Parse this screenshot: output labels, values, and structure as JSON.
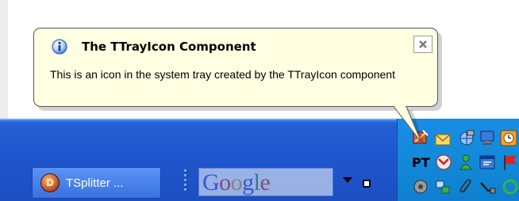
{
  "balloon": {
    "title": "The TTrayIcon Component",
    "message": "This is an icon in the system tray created by the TTrayIcon component",
    "info_icon": "info-icon",
    "close_icon": "close-icon",
    "background_color": "#ffffe1"
  },
  "taskbar": {
    "color": "#1f55cc",
    "task_button": {
      "label": "TSplitter ...",
      "app_icon": "delphi-app-icon",
      "app_icon_glyph": "D"
    },
    "search": {
      "logo_parts": [
        "G",
        "o",
        "o",
        "g",
        "l",
        "e"
      ],
      "logo_colors": [
        "#3a66d8",
        "#d8463a",
        "#d8b13a",
        "#3a66d8",
        "#3aa34a",
        "#d8463a"
      ]
    },
    "dropdown_icon": "chevron-down-icon",
    "restore_icon": "restore-icon"
  },
  "tray": {
    "color": "#128ad8",
    "icons": [
      "custom-tray-icon",
      "mail-icon",
      "network-globe-icon",
      "monitor-icon",
      "clock-icon",
      "pt-text-icon",
      "gmail-icon",
      "messenger-icon",
      "window-icon",
      "flag-icon",
      "speaker-icon",
      "connection-icon",
      "paperclip-icon",
      "usb-icon",
      "refresh-icon"
    ],
    "pt_text": "PT"
  }
}
